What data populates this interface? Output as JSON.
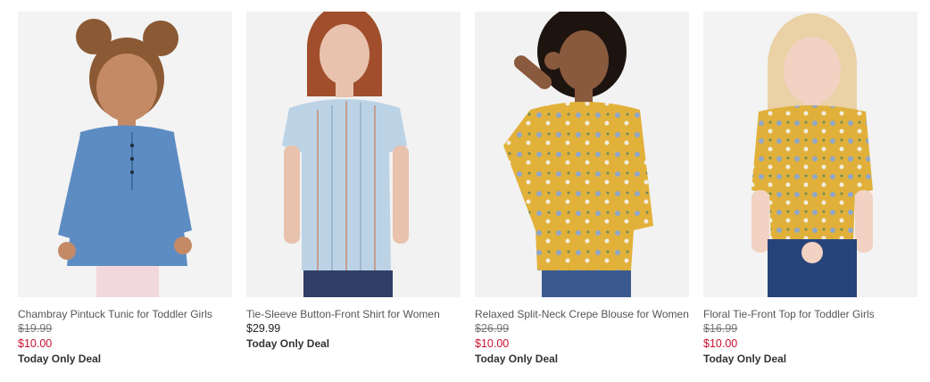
{
  "products": [
    {
      "image_alt": "toddler girl in chambray pintuck tunic",
      "name": "Chambray Pintuck Tunic for Toddler Girls",
      "original_price": "$19.99",
      "sale_price": "$10.00",
      "badge": "Today Only Deal",
      "colors": {
        "top": "#5d8cc3",
        "hair": "#8b5a35",
        "skin": "#c48a66",
        "bottom": "#f2d8dc"
      }
    },
    {
      "image_alt": "woman in striped tie-sleeve button-front shirt",
      "name": "Tie-Sleeve Button-Front Shirt for Women",
      "price": "$29.99",
      "badge": "Today Only Deal",
      "colors": {
        "top": "#bcd3e6",
        "hair": "#a04e2c",
        "skin": "#e8c2ad",
        "bottom": "#2f3f66"
      }
    },
    {
      "image_alt": "woman in yellow floral split-neck crepe blouse",
      "name": "Relaxed Split-Neck Crepe Blouse for Women",
      "original_price": "$26.99",
      "sale_price": "$10.00",
      "badge": "Today Only Deal",
      "colors": {
        "top": "#e2b13a",
        "hair": "#1d1410",
        "skin": "#8a5a3e",
        "bottom": "#3a5a8e"
      }
    },
    {
      "image_alt": "toddler girl in yellow floral tie-front top",
      "name": "Floral Tie-Front Top for Toddler Girls",
      "original_price": "$16.99",
      "sale_price": "$10.00",
      "badge": "Today Only Deal",
      "colors": {
        "top": "#e0b03a",
        "hair": "#ead1a6",
        "skin": "#f2d2c2",
        "bottom": "#27447a"
      }
    }
  ]
}
